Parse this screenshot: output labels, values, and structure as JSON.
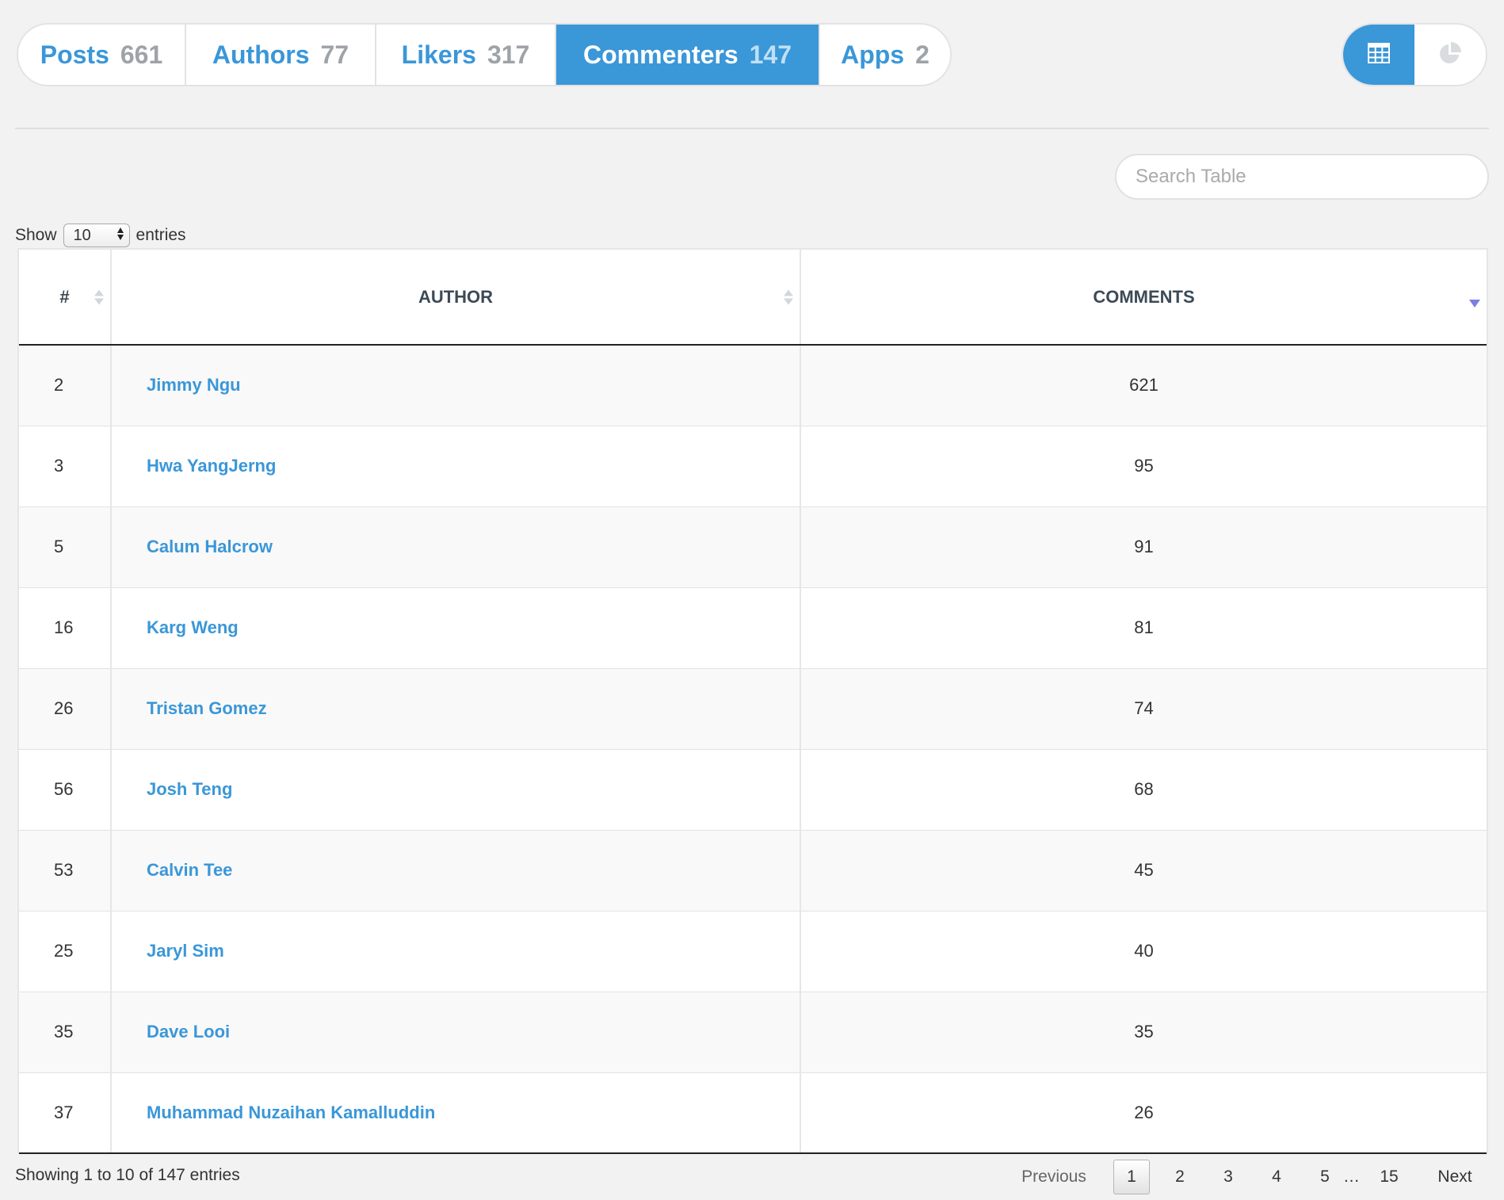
{
  "tabs": [
    {
      "label": "Posts",
      "count": "661"
    },
    {
      "label": "Authors",
      "count": "77"
    },
    {
      "label": "Likers",
      "count": "317"
    },
    {
      "label": "Commenters",
      "count": "147",
      "active": true
    },
    {
      "label": "Apps",
      "count": "2"
    }
  ],
  "view_toggle": {
    "table_icon": "table-grid-icon",
    "chart_icon": "pie-chart-icon",
    "active": "table"
  },
  "search": {
    "placeholder": "Search Table",
    "value": ""
  },
  "length": {
    "prefix": "Show",
    "value": "10",
    "suffix": "entries"
  },
  "table": {
    "columns": [
      {
        "label": "#"
      },
      {
        "label": "AUTHOR"
      },
      {
        "label": "COMMENTS"
      }
    ],
    "rows": [
      {
        "num": "2",
        "author": "Jimmy Ngu",
        "comments": "621"
      },
      {
        "num": "3",
        "author": "Hwa YangJerng",
        "comments": "95"
      },
      {
        "num": "5",
        "author": "Calum Halcrow",
        "comments": "91"
      },
      {
        "num": "16",
        "author": "Karg Weng",
        "comments": "81"
      },
      {
        "num": "26",
        "author": "Tristan Gomez",
        "comments": "74"
      },
      {
        "num": "56",
        "author": "Josh Teng",
        "comments": "68"
      },
      {
        "num": "53",
        "author": "Calvin Tee",
        "comments": "45"
      },
      {
        "num": "25",
        "author": "Jaryl Sim",
        "comments": "40"
      },
      {
        "num": "35",
        "author": "Dave Looi",
        "comments": "35"
      },
      {
        "num": "37",
        "author": "Muhammad Nuzaihan Kamalluddin",
        "comments": "26"
      }
    ]
  },
  "footer": {
    "info": "Showing 1 to 10 of 147 entries",
    "previous": "Previous",
    "next": "Next",
    "pages": [
      "1",
      "2",
      "3",
      "4",
      "5"
    ],
    "ellipsis": "…",
    "last_page": "15",
    "current_page": "1"
  },
  "colors": {
    "accent": "#3a97d8",
    "background": "#f2f2f2",
    "count_grey": "#9ea3a8",
    "sort_active": "#7b7fe0"
  }
}
